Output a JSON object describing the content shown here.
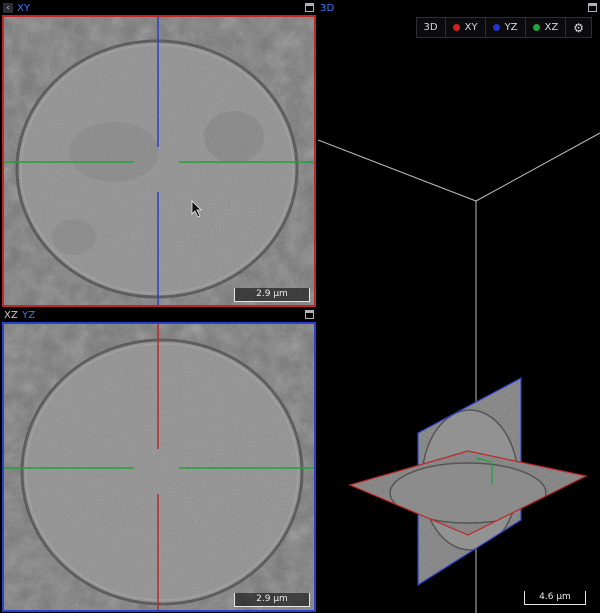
{
  "xy_panel": {
    "tab_label": "XY",
    "scalebar": "2.9 µm"
  },
  "xz_panel": {
    "tabs": [
      "XZ",
      "YZ"
    ],
    "scalebar": "2.9 µm"
  },
  "view3d": {
    "tab_label": "3D",
    "scalebar": "4.6 µm"
  },
  "toolbar": {
    "items": [
      {
        "label": "3D",
        "color": ""
      },
      {
        "label": "XY",
        "color": "#d81f1f"
      },
      {
        "label": "YZ",
        "color": "#2233cc"
      },
      {
        "label": "XZ",
        "color": "#1fa33b"
      }
    ],
    "settings_icon": "gear-icon"
  },
  "colors": {
    "xy": "#c02626",
    "yz": "#2a3fd0",
    "xz": "#22a23a",
    "active_tab": "#3a78ff"
  },
  "icons": {
    "nav_left": "chevron-left-icon",
    "nav_right": "chevron-right-icon",
    "maximize": "maximize-icon"
  }
}
